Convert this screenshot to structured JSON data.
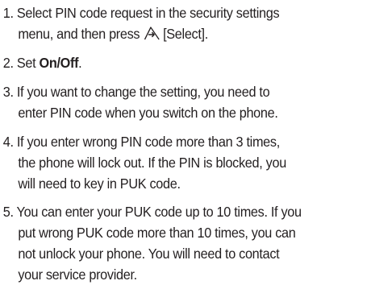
{
  "steps": [
    {
      "number": "1.",
      "line1": "Select PIN code request in the security settings",
      "line2_before": "menu, and then press",
      "icon": "right-softkey-icon",
      "line2_after": "[Select]."
    },
    {
      "number": "2.",
      "text_before": "Set",
      "bold_text": "On/Off",
      "text_after": "."
    },
    {
      "number": "3.",
      "line1": "If you want to change the setting, you need to",
      "line2": "enter PIN code when you switch on the phone."
    },
    {
      "number": "4.",
      "line1": "If you enter wrong PIN code more than 3 times,",
      "line2": "the phone will lock out. If the PIN is blocked, you",
      "line3": "will need to key in PUK code."
    },
    {
      "number": "5.",
      "line1": "You can enter your PUK code up to 10 times. If you",
      "line2": "put wrong PUK code more than 10 times, you can",
      "line3": "not unlock your phone. You will need to contact",
      "line4": "your service provider."
    }
  ]
}
